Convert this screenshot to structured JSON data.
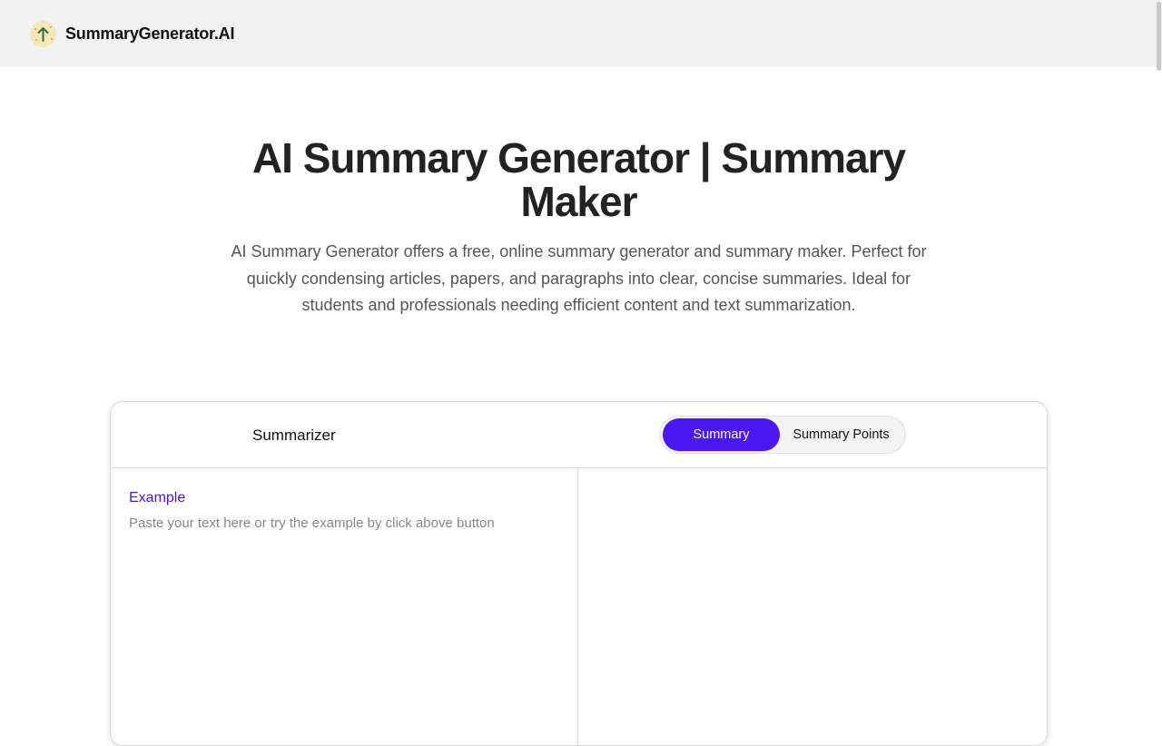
{
  "header": {
    "brand": "SummaryGenerator.AI",
    "logo_icon": "arrow-up-icon"
  },
  "hero": {
    "title": "AI Summary Generator | Summary Maker",
    "description": "AI Summary Generator offers a free, online summary generator and summary maker. Perfect for quickly condensing articles, papers, and paragraphs into clear, concise summaries. Ideal for students and professionals needing efficient content and text summarization."
  },
  "summarizer": {
    "title": "Summarizer",
    "modes": [
      "Summary",
      "Summary Points"
    ],
    "active_mode": "Summary",
    "example_link": "Example",
    "input_placeholder": "Paste your text here or try the example by click above button",
    "input_value": ""
  },
  "colors": {
    "accent": "#4a17f0",
    "header_bg": "#f2f2f2",
    "logo_bg": "#f6e7b9"
  }
}
